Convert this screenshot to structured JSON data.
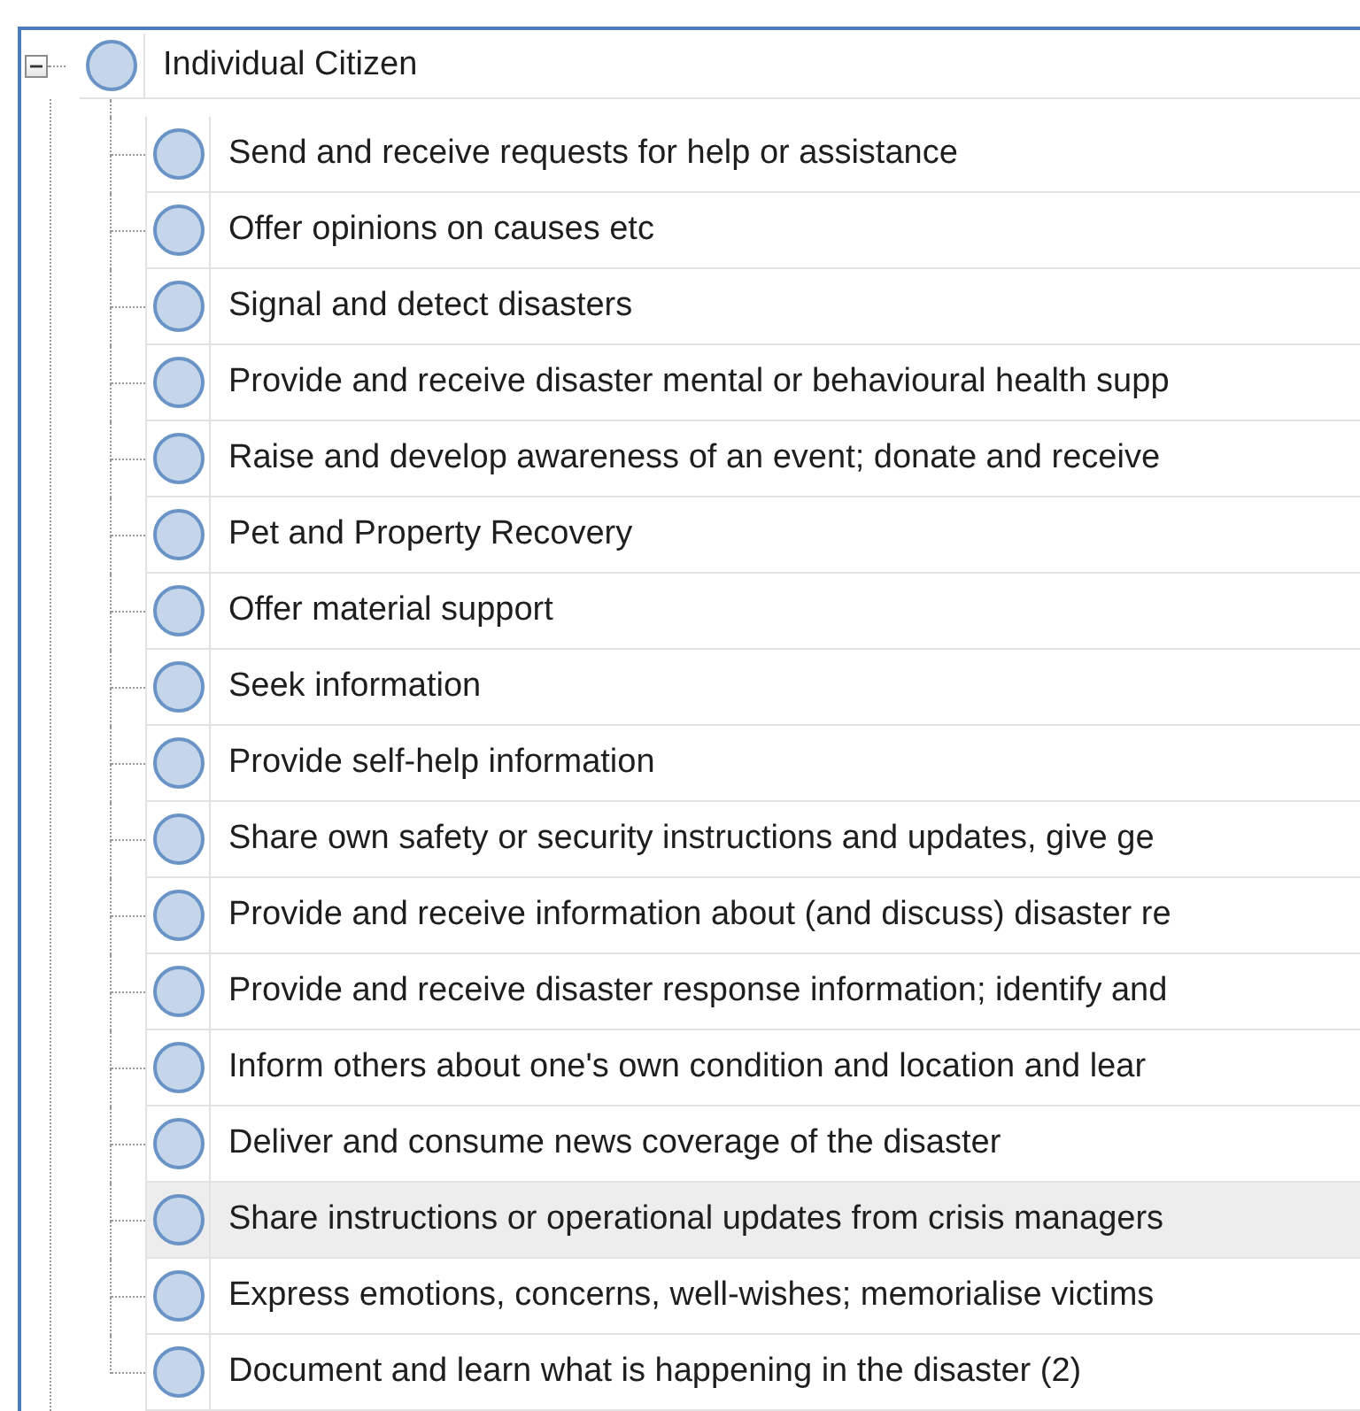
{
  "tree": [
    {
      "label": "Individual Citizen",
      "expanded": true,
      "children": [
        {
          "label": "Send and receive requests for help or assistance",
          "selected": false
        },
        {
          "label": "Offer opinions on causes etc",
          "selected": false
        },
        {
          "label": "Signal and detect disasters",
          "selected": false
        },
        {
          "label": "Provide and receive disaster mental or behavioural health supp",
          "selected": false
        },
        {
          "label": "Raise and develop awareness of an event; donate and receive",
          "selected": false
        },
        {
          "label": "Pet and Property Recovery",
          "selected": false
        },
        {
          "label": "Offer material support",
          "selected": false
        },
        {
          "label": "Seek information",
          "selected": false
        },
        {
          "label": "Provide self-help information",
          "selected": false
        },
        {
          "label": "Share own safety or security instructions and updates, give ge",
          "selected": false
        },
        {
          "label": "Provide and receive information about (and discuss) disaster re",
          "selected": false
        },
        {
          "label": "Provide and receive disaster response information; identify and",
          "selected": false
        },
        {
          "label": "Inform others about one's own condition and location and lear",
          "selected": false
        },
        {
          "label": "Deliver and consume news coverage of the disaster",
          "selected": false
        },
        {
          "label": "Share instructions or operational updates from crisis managers",
          "selected": true
        },
        {
          "label": "Express emotions, concerns, well-wishes; memorialise victims",
          "selected": false
        },
        {
          "label": "Document and learn what is happening in the disaster (2)",
          "selected": false
        }
      ]
    }
  ]
}
